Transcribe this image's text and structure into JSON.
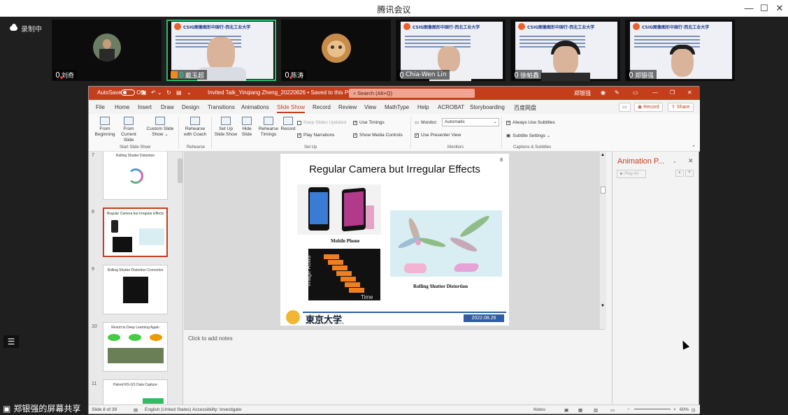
{
  "window": {
    "title": "腾讯会议",
    "min": "—",
    "max": "☐",
    "close": "✕"
  },
  "meeting": {
    "recording": "录制中",
    "participants": [
      {
        "name": "刘奇",
        "muted": true
      },
      {
        "name": "戴玉超",
        "muted": false,
        "host": true
      },
      {
        "name": "陈涛",
        "muted": true
      },
      {
        "name": "Chia-Wen Lin",
        "muted": false
      },
      {
        "name": "徐帕鑫",
        "muted": false
      },
      {
        "name": "郑银强",
        "muted": false
      }
    ],
    "thumb_header": "CSIG图像图形中国行·西北工业大学",
    "share_label": "郑银强的屏幕共享"
  },
  "ppt": {
    "autosave": "AutoSave",
    "autosave_state": "Off",
    "doc_title": "Invited Talk_Yinqiang Zheng_20220826 • Saved to this PC ⌄",
    "search": "Search (Alt+Q)",
    "user": "郑银强",
    "menu": [
      "File",
      "Home",
      "Insert",
      "Draw",
      "Design",
      "Transitions",
      "Animations",
      "Slide Show",
      "Record",
      "Review",
      "View",
      "MathType",
      "Help",
      "ACROBAT",
      "Storyboarding",
      "百度网盘"
    ],
    "record_btn": "Record",
    "share_btn": "Share",
    "ribbon": {
      "from_beginning": "From Beginning",
      "from_current": "From Current Slide",
      "custom": "Custom Slide Show ⌄",
      "rehearse_coach": "Rehearse with Coach",
      "setup_show": "Set Up Slide Show",
      "hide_slide": "Hide Slide",
      "rehearse_timings": "Rehearse Timings",
      "record": "Record",
      "keep_updated": "Keep Slides Updated",
      "play_narrations": "Play Narrations",
      "use_timings": "Use Timings",
      "show_media": "Show Media Controls",
      "monitor": "Monitor:",
      "monitor_value": "Automatic",
      "presenter_view": "Use Presenter View",
      "always_subtitles": "Always Use Subtitles",
      "subtitle_settings": "Subtitle Settings ⌄",
      "groups": [
        "Start Slide Show",
        "Rehearse",
        "Set Up",
        "Monitors",
        "Captions & Subtitles"
      ]
    },
    "thumbs": [
      {
        "num": "7",
        "title": "Rolling Shutter Distortion"
      },
      {
        "num": "8",
        "title": "Regular Camera but Irregular Effects"
      },
      {
        "num": "9",
        "title": "Rolling Shutter Distortion Correction"
      },
      {
        "num": "10",
        "title": "Resort to Deep Learning Again"
      },
      {
        "num": "11",
        "title": "Paired RS-GS Data Capture"
      }
    ],
    "slide": {
      "title": "Regular Camera but Irregular Effects",
      "page": "8",
      "cap_phone": "Mobile Phone",
      "cap_rs": "Rolling Shutter Distortion",
      "ylabel": "Image Rows",
      "xlabel": "Time",
      "univ": "東京大学",
      "univ_en": "THE UNIVERSITY OF TOKYO",
      "date": "2022.08.26"
    },
    "notes_placeholder": "Click to add notes",
    "anim_pane": {
      "title": "Animation P...",
      "play_all": "▶ Play All"
    },
    "status": {
      "slide": "Slide 8 of 39",
      "lang": "English (United States)",
      "access": "Accessibility: Investigate",
      "notes": "Notes",
      "zoom": "60%"
    }
  }
}
